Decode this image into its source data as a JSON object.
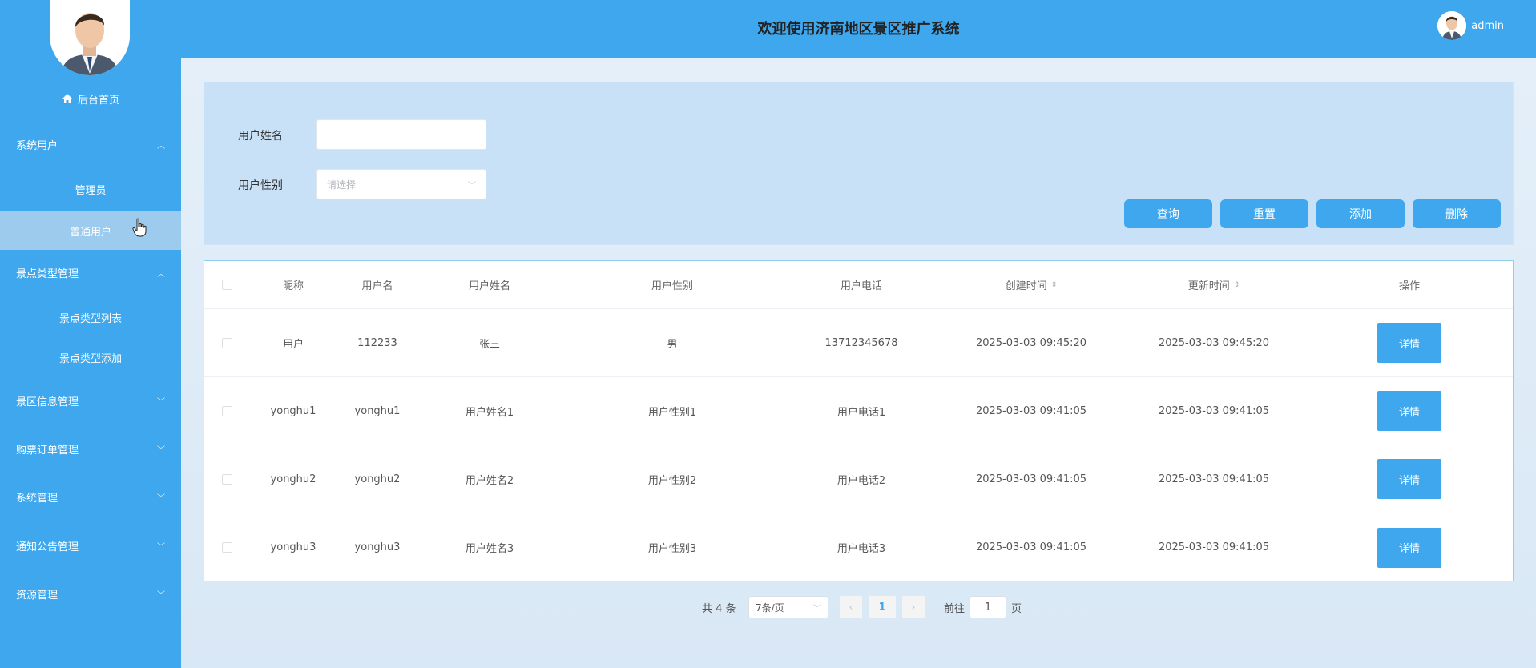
{
  "header": {
    "title": "欢迎使用济南地区景区推广系统",
    "username": "admin"
  },
  "sidebar": {
    "home": "后台首页",
    "groups": [
      {
        "label": "系统用户",
        "expanded": true,
        "subs": [
          "管理员",
          "普通用户"
        ]
      },
      {
        "label": "景点类型管理",
        "expanded": true,
        "subs": [
          "景点类型列表",
          "景点类型添加"
        ]
      },
      {
        "label": "景区信息管理",
        "expanded": false
      },
      {
        "label": "购票订单管理",
        "expanded": false
      },
      {
        "label": "系统管理",
        "expanded": false
      },
      {
        "label": "通知公告管理",
        "expanded": false
      },
      {
        "label": "资源管理",
        "expanded": false
      }
    ],
    "active_item": "普通用户"
  },
  "filters": {
    "name_label": "用户姓名",
    "name_value": "",
    "gender_label": "用户性别",
    "gender_placeholder": "请选择"
  },
  "buttons": {
    "query": "查询",
    "reset": "重置",
    "add": "添加",
    "delete": "删除"
  },
  "table": {
    "columns": [
      "昵称",
      "用户名",
      "用户姓名",
      "用户性别",
      "用户电话",
      "创建时间",
      "更新时间",
      "操作"
    ],
    "rows": [
      {
        "nickname": "用户",
        "username": "112233",
        "realname": "张三",
        "gender": "男",
        "phone": "13712345678",
        "created": "2025-03-03 09:45:20",
        "updated": "2025-03-03 09:45:20",
        "action": "详情"
      },
      {
        "nickname": "yonghu1",
        "username": "yonghu1",
        "realname": "用户姓名1",
        "gender": "用户性别1",
        "phone": "用户电话1",
        "created": "2025-03-03 09:41:05",
        "updated": "2025-03-03 09:41:05",
        "action": "详情"
      },
      {
        "nickname": "yonghu2",
        "username": "yonghu2",
        "realname": "用户姓名2",
        "gender": "用户性别2",
        "phone": "用户电话2",
        "created": "2025-03-03 09:41:05",
        "updated": "2025-03-03 09:41:05",
        "action": "详情"
      },
      {
        "nickname": "yonghu3",
        "username": "yonghu3",
        "realname": "用户姓名3",
        "gender": "用户性别3",
        "phone": "用户电话3",
        "created": "2025-03-03 09:41:05",
        "updated": "2025-03-03 09:41:05",
        "action": "详情"
      }
    ]
  },
  "pagination": {
    "total": "共 4 条",
    "page_size": "7条/页",
    "current_page": "1",
    "goto_label": "前往",
    "goto_value": "1",
    "page_suffix": "页"
  },
  "colors": {
    "primary": "#3ea7ee",
    "active_menu": "#9ccbee",
    "panel": "#c8e1f6"
  }
}
